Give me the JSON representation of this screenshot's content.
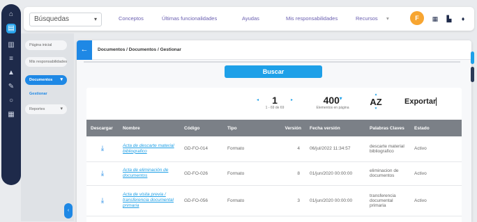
{
  "topbar": {
    "search_label": "Búsquedas",
    "menu": [
      "Conceptos",
      "Últimas funcionalidades",
      "Ayudas",
      "Mis responsabilidades",
      "Recursos"
    ],
    "avatar_initial": "F"
  },
  "sidebar": {
    "items": [
      {
        "label": "Página inicial"
      },
      {
        "label": "Mis responsabilidades"
      },
      {
        "label": "Documentos"
      },
      {
        "label": "Gestionar"
      },
      {
        "label": "Reportes"
      }
    ]
  },
  "panel": {
    "breadcrumb": "Documentos / Documentos / Gestionar",
    "search_button": "Buscar"
  },
  "results": {
    "page": "1",
    "range": "1 - 69 de 69",
    "page_size": "400",
    "page_size_label": "Elementos en página",
    "sort_label": "AZ",
    "export_label": "Exportar",
    "columns": [
      "Descargar",
      "Nombre",
      "Código",
      "Tipo",
      "Versión",
      "Fecha versión",
      "Palabras Claves",
      "Estado"
    ],
    "rows": [
      {
        "name": "Acta de descarte material bibliografico",
        "code": "GD-FO-014",
        "type": "Formato",
        "version": "4",
        "date": "06/jul/2022 11:34:57",
        "keywords": "descarte material bibliografico",
        "status": "Activo"
      },
      {
        "name": "Acta de eliminación de documentos",
        "code": "GD-FO-026",
        "type": "Formato",
        "version": "8",
        "date": "01/jun/2020 00:00:00",
        "keywords": "eliminacion de documentos",
        "status": "Activo"
      },
      {
        "name": "Acta de visita previa / transferencia documental primaria",
        "code": "GD-FO-056",
        "type": "Formato",
        "version": "3",
        "date": "01/jun/2020 00:00:00",
        "keywords": "transferencia documental primaria",
        "status": "Activo"
      }
    ]
  },
  "colors": {
    "rail": "#1e2a4a",
    "accent": "#1ea0e8",
    "header_gray": "#7b8087",
    "avatar": "#f7a531"
  }
}
